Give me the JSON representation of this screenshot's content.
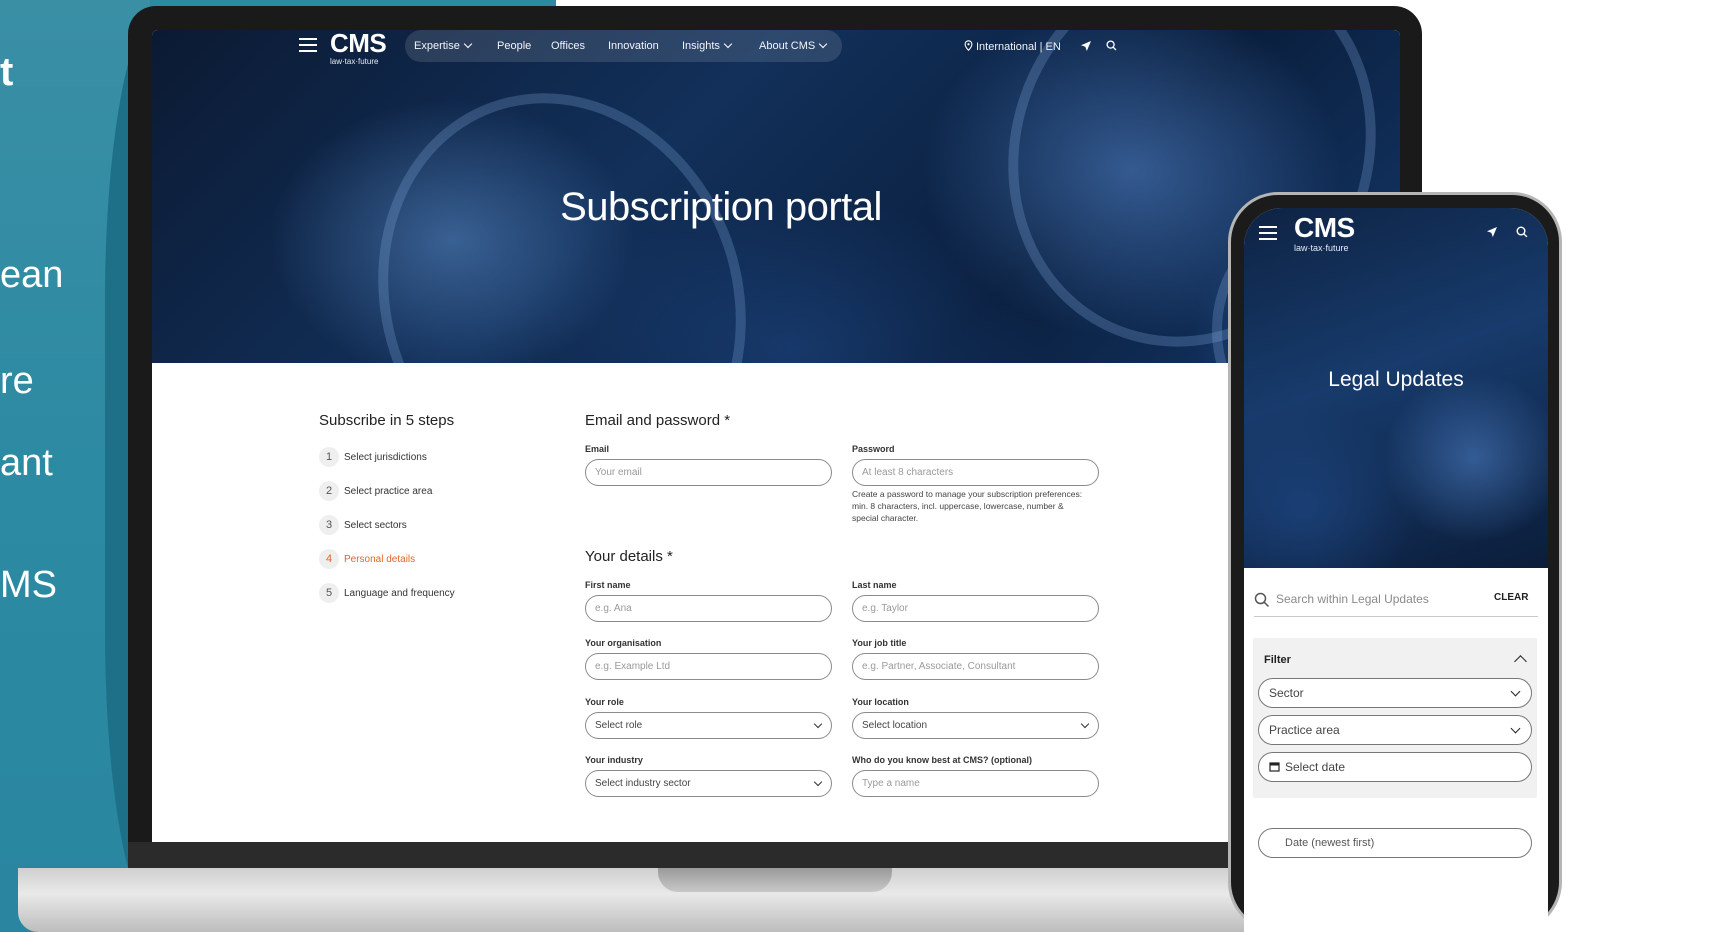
{
  "slide": {
    "fragments": [
      "t",
      "ean",
      "re",
      "ant",
      "MS"
    ]
  },
  "laptop": {
    "brand": {
      "name": "CMS",
      "tagline": "law·tax·future"
    },
    "nav": {
      "items": [
        {
          "label": "Expertise",
          "dropdown": true
        },
        {
          "label": "People",
          "dropdown": false
        },
        {
          "label": "Offices",
          "dropdown": false
        },
        {
          "label": "Innovation",
          "dropdown": false
        },
        {
          "label": "Insights",
          "dropdown": true
        },
        {
          "label": "About CMS",
          "dropdown": true
        }
      ],
      "locale": "International | EN"
    },
    "hero_title": "Subscription portal",
    "steps": {
      "title": "Subscribe in 5 steps",
      "items": [
        {
          "num": "1",
          "label": "Select jurisdictions"
        },
        {
          "num": "2",
          "label": "Select practice area"
        },
        {
          "num": "3",
          "label": "Select sectors"
        },
        {
          "num": "4",
          "label": "Personal details",
          "active": true
        },
        {
          "num": "5",
          "label": "Language and frequency"
        }
      ]
    },
    "email_section": {
      "title": "Email and password *",
      "email_label": "Email",
      "email_placeholder": "Your email",
      "password_label": "Password",
      "password_placeholder": "At least 8 characters",
      "password_help_1": "Create a password to manage your subscription preferences:",
      "password_help_2": "min. 8 characters, incl. uppercase, lowercase, number &",
      "password_help_3": "special character."
    },
    "details_section": {
      "title": "Your details *",
      "first_name_label": "First name",
      "first_name_placeholder": "e.g. Ana",
      "last_name_label": "Last name",
      "last_name_placeholder": "e.g. Taylor",
      "org_label": "Your organisation",
      "org_placeholder": "e.g. Example Ltd",
      "job_label": "Your job title",
      "job_placeholder": "e.g. Partner, Associate, Consultant",
      "role_label": "Your role",
      "role_value": "Select role",
      "location_label": "Your location",
      "location_value": "Select location",
      "industry_label": "Your industry",
      "industry_value": "Select industry sector",
      "contact_label": "Who do you know best at CMS? (optional)",
      "contact_placeholder": "Type a name"
    }
  },
  "phone": {
    "brand": {
      "name": "CMS",
      "tagline": "law·tax·future"
    },
    "hero_title": "Legal Updates",
    "search_placeholder": "Search within Legal Updates",
    "clear_label": "CLEAR",
    "filter": {
      "title": "Filter",
      "sector": "Sector",
      "practice_area": "Practice area",
      "date": "Select date"
    },
    "sort_partial": "Date (newest first)"
  },
  "colors": {
    "slide_teal": "#2c8aa2",
    "active_step": "#e0662a",
    "hero_navy": "#12305a"
  }
}
